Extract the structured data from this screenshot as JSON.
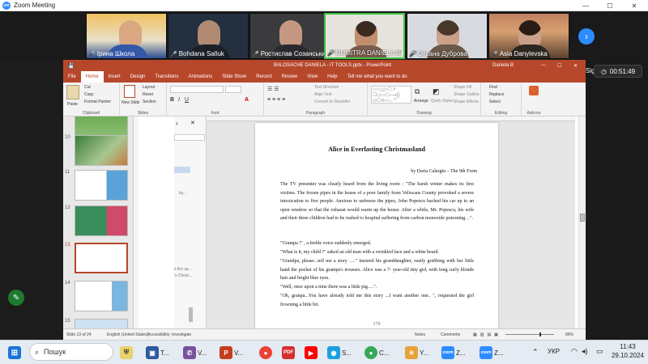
{
  "zoom": {
    "title": "Zoom Meeting",
    "logo": "zm",
    "timer": "00:51:49",
    "sign_in": "Sign in"
  },
  "participants": [
    {
      "name": "Ірина Школа"
    },
    {
      "name": "Bohdana Salluk"
    },
    {
      "name": "Ростислав Созанський"
    },
    {
      "name": "DUMITRA DANIELA BALO..."
    },
    {
      "name": "Оксана Дуброва"
    },
    {
      "name": "Asia Danylevska"
    }
  ],
  "ppt": {
    "title": "BALOSACHE DANIELA - IT TOOLS.pptx - PowerPoint",
    "user": "Daniela B",
    "tabs": [
      "File",
      "Home",
      "Insert",
      "Design",
      "Transitions",
      "Animations",
      "Slide Show",
      "Record",
      "Review",
      "View",
      "Help",
      "Tell me what you want to do"
    ],
    "ribbon": {
      "paste": "Paste",
      "cut": "Cut",
      "copy": "Copy",
      "format_painter": "Format Painter",
      "clipboard": "Clipboard",
      "new_slide": "New Slide",
      "layout": "Layout",
      "reset": "Reset",
      "section": "Section",
      "slides": "Slides",
      "font": "Font",
      "paragraph": "Paragraph",
      "text_direction": "Text Direction",
      "align_text": "Align Text",
      "convert_smartart": "Convert to SmartArt",
      "arrange": "Arrange",
      "quick_styles": "Quick Styles",
      "shape_fill": "Shape Fill",
      "shape_outline": "Shape Outline",
      "shape_effects": "Shape Effects",
      "drawing": "Drawing",
      "find": "Find",
      "replace": "Replace",
      "select": "Select",
      "editing": "Editing",
      "addin": "Add-ins"
    },
    "slide_numbers": [
      "10",
      "11",
      "12",
      "13",
      "14",
      "15"
    ],
    "outline_frag": [
      "by...",
      "s the up...",
      "'s Christ..."
    ],
    "document": {
      "title": "Alice in Everlasting Christmasland",
      "byline": "by Daria Calargiu – The 9th Form",
      "para1": "The TV presenter was clearly heard from the living room : \"The harsh winter makes its first victims. The frozen pipes in the house of a poor family from Veliscaus County provoked a severe intoxication to five people. Anxious to unfreeze the pipes, John Popescu backed his car up to an open window so that the exhaust would warm up the house. After a while, Mr. Popescu, his wife and their three children had to be rushed to hospital suffering from carbon monoxide poisoning…\".",
      "p2": "\"Grampa !\" , a feeble voice suddenly emerged.",
      "p3": "\"What is it, my child ?\" asked an old man with a wrinkled face and a white beard.",
      "p4": "\"Grandpa, please...tell me a story ….\" insisted his granddaughter, easily grabbing with her little hand the pocket of his grampa's trousers. Alice was a 7- year-old tiny girl, with long curly blonde hair and bright blue eyes.",
      "p5": "\"Well, once upon a time there was a little pig….\".",
      "p6": "\"Oh, granpa...You have already told me this story ...I want another one.. \", requested the girl frowning a little bit.",
      "page_number": "179"
    },
    "status": {
      "slide": "Slide 13 of 24",
      "language": "English (United States)",
      "accessibility": "Accessibility: Investigate",
      "notes": "Notes",
      "comments": "Comments",
      "zoom_pct": "86%"
    }
  },
  "taskbar": {
    "search": "Пошук",
    "items": [
      {
        "label": "T..."
      },
      {
        "label": "V..."
      },
      {
        "label": "V..."
      },
      {
        "label": "S..."
      },
      {
        "label": "C..."
      },
      {
        "label": "Y..."
      },
      {
        "label": "Z..."
      },
      {
        "label": "Z..."
      }
    ],
    "lang": "УКР",
    "time": "11:43",
    "date": "29.10.2024"
  },
  "colors": {
    "ppt_accent": "#b7472a",
    "zoom_blue": "#2d8cff"
  }
}
